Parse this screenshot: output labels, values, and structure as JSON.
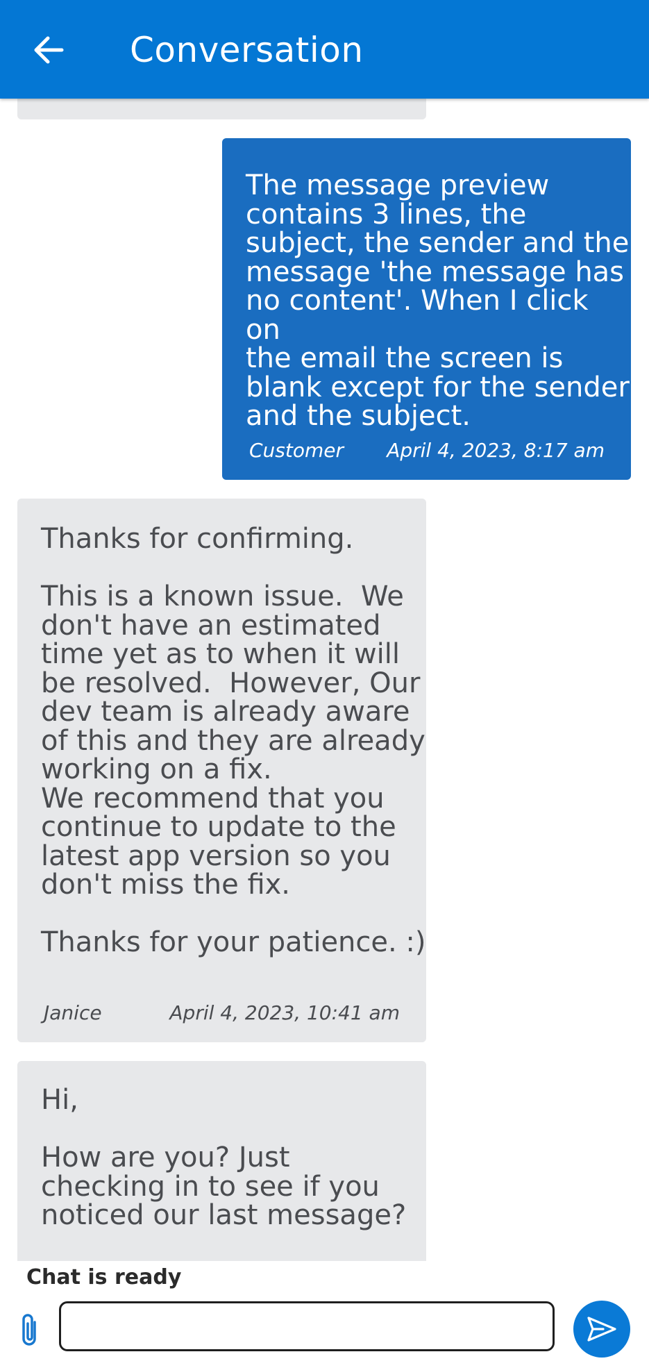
{
  "header": {
    "title": "Conversation",
    "back_icon": "arrow-left-icon"
  },
  "messages": [
    {
      "sender": "Customer",
      "role": "customer",
      "text": "The message preview\ncontains 3 lines, the\nsubject, the sender and the\nmessage 'the message has\nno content'. When I click on\nthe email the screen is\nblank except for the sender\nand the subject.",
      "timestamp": "April 4, 2023, 8:17 am"
    },
    {
      "sender": "Janice",
      "role": "agent",
      "text": "Thanks for confirming.\n\nThis is a known issue.  We\ndon't have an estimated\ntime yet as to when it will\nbe resolved.  However, Our\ndev team is already aware\nof this and they are already\nworking on a fix.\nWe recommend that you\ncontinue to update to the\nlatest app version so you\ndon't miss the fix.\n\nThanks for your patience. :)",
      "timestamp": "April 4, 2023, 10:41 am"
    },
    {
      "role": "agent",
      "text": "Hi,\n\nHow are you? Just\nchecking in to see if you\nnoticed our last message?"
    }
  ],
  "status": "Chat is ready",
  "composer": {
    "value": "",
    "placeholder": "",
    "attach_icon": "paperclip-icon",
    "send_icon": "send-icon"
  },
  "colors": {
    "header": "#0477d4",
    "customer_bubble": "#1a6dc0",
    "agent_bubble": "#e7e8ea",
    "send_button": "#0a7ad6"
  }
}
